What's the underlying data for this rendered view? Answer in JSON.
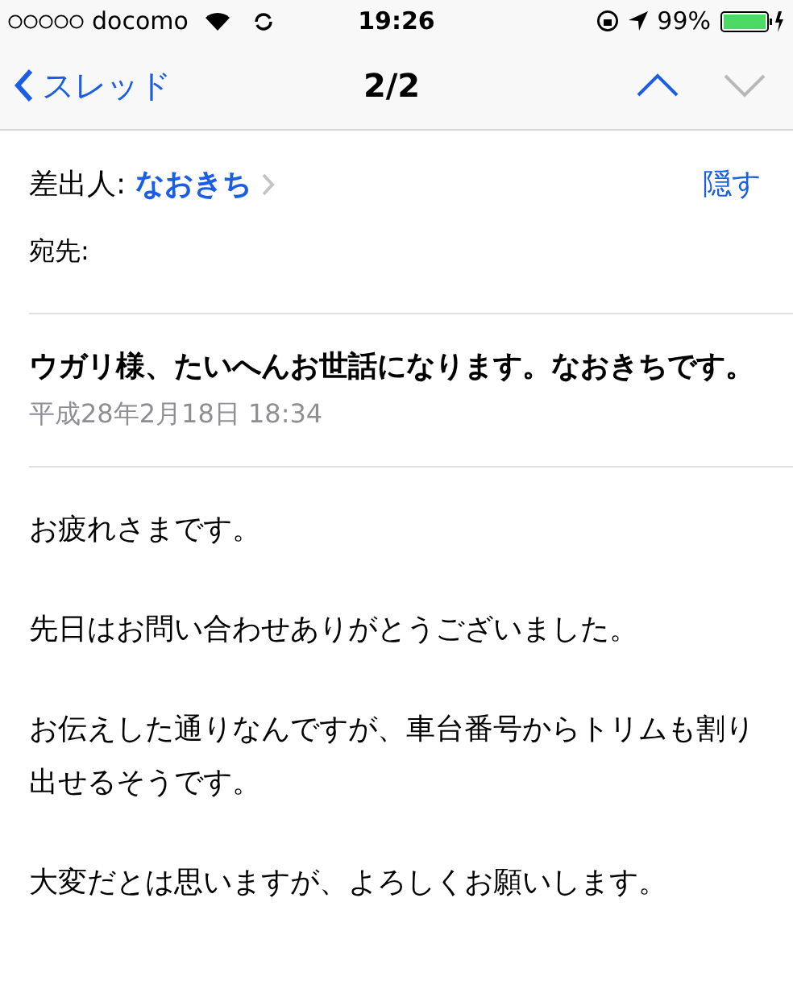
{
  "status_bar": {
    "carrier": "docomo",
    "time": "19:26",
    "battery": "99%"
  },
  "nav": {
    "back": "スレッド",
    "title": "2/2",
    "buttons": [
      {
        "kind": "up",
        "disabled": false
      },
      {
        "kind": "down",
        "disabled": true
      }
    ]
  },
  "header": {
    "from_label": "差出人:",
    "from": "なおきち",
    "hide": "隠す",
    "to_label": "宛先:"
  },
  "subject": "ウガリ様、たいへんお世話になります。なおきちです。",
  "date": "平成28年2月18日 18:34",
  "body": [
    "お疲れさまです。",
    "先日はお問い合わせありがとうございました。",
    "お伝えした通りなんですが、車台番号からトリムも割り出せるそうです。",
    "大変だとは思いますが、よろしくお願いします。"
  ]
}
